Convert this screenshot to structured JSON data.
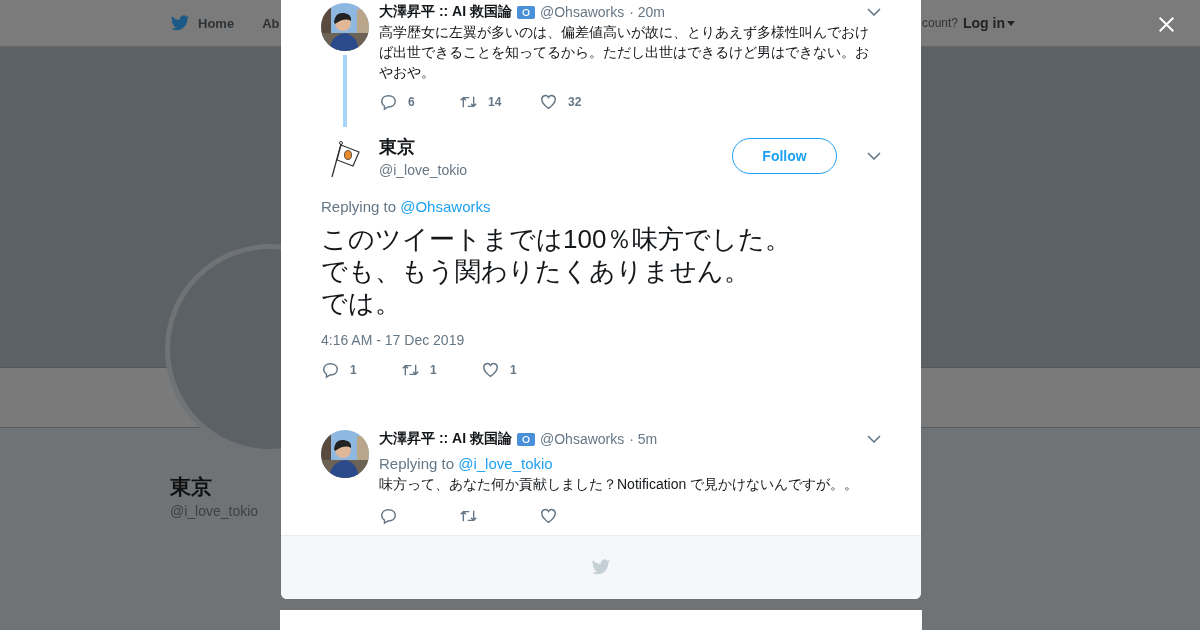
{
  "nav": {
    "items": [
      {
        "label": "Home"
      },
      {
        "label": "Ab"
      }
    ],
    "login_prompt": "count?",
    "login": "Log in"
  },
  "profile": {
    "name": "東京",
    "handle": "@i_love_tokio"
  },
  "tweets": [
    {
      "kind": "parent",
      "name": "大澤昇平 :: AI 救国論",
      "handle": "@Ohsaworks",
      "time": "· 20m",
      "text": "高学歴女に左翼が多いのは、偏差値高いが故に、とりあえず多様性叫んでおけば出世できることを知ってるから。ただし出世はできるけど男はできない。おやおや。",
      "replies": "6",
      "retweets": "14",
      "likes": "32"
    },
    {
      "kind": "main",
      "name": "東京",
      "handle": "@i_love_tokio",
      "follow": "Follow",
      "replying_label": "Replying to",
      "replying_to": "@Ohsaworks",
      "lines": [
        "このツイートまでは100％味方でした。",
        "でも、もう関わりたくありません。",
        "では。"
      ],
      "timestamp": "4:16 AM - 17 Dec 2019",
      "replies": "1",
      "retweets": "1",
      "likes": "1"
    },
    {
      "kind": "reply",
      "name": "大澤昇平 :: AI 救国論",
      "handle": "@Ohsaworks",
      "time": "· 5m",
      "replying_label": "Replying to",
      "replying_to": "@i_love_tokio",
      "text": "味方って、あなた何か貢献しました？Notification で見かけないんですが。。"
    }
  ]
}
